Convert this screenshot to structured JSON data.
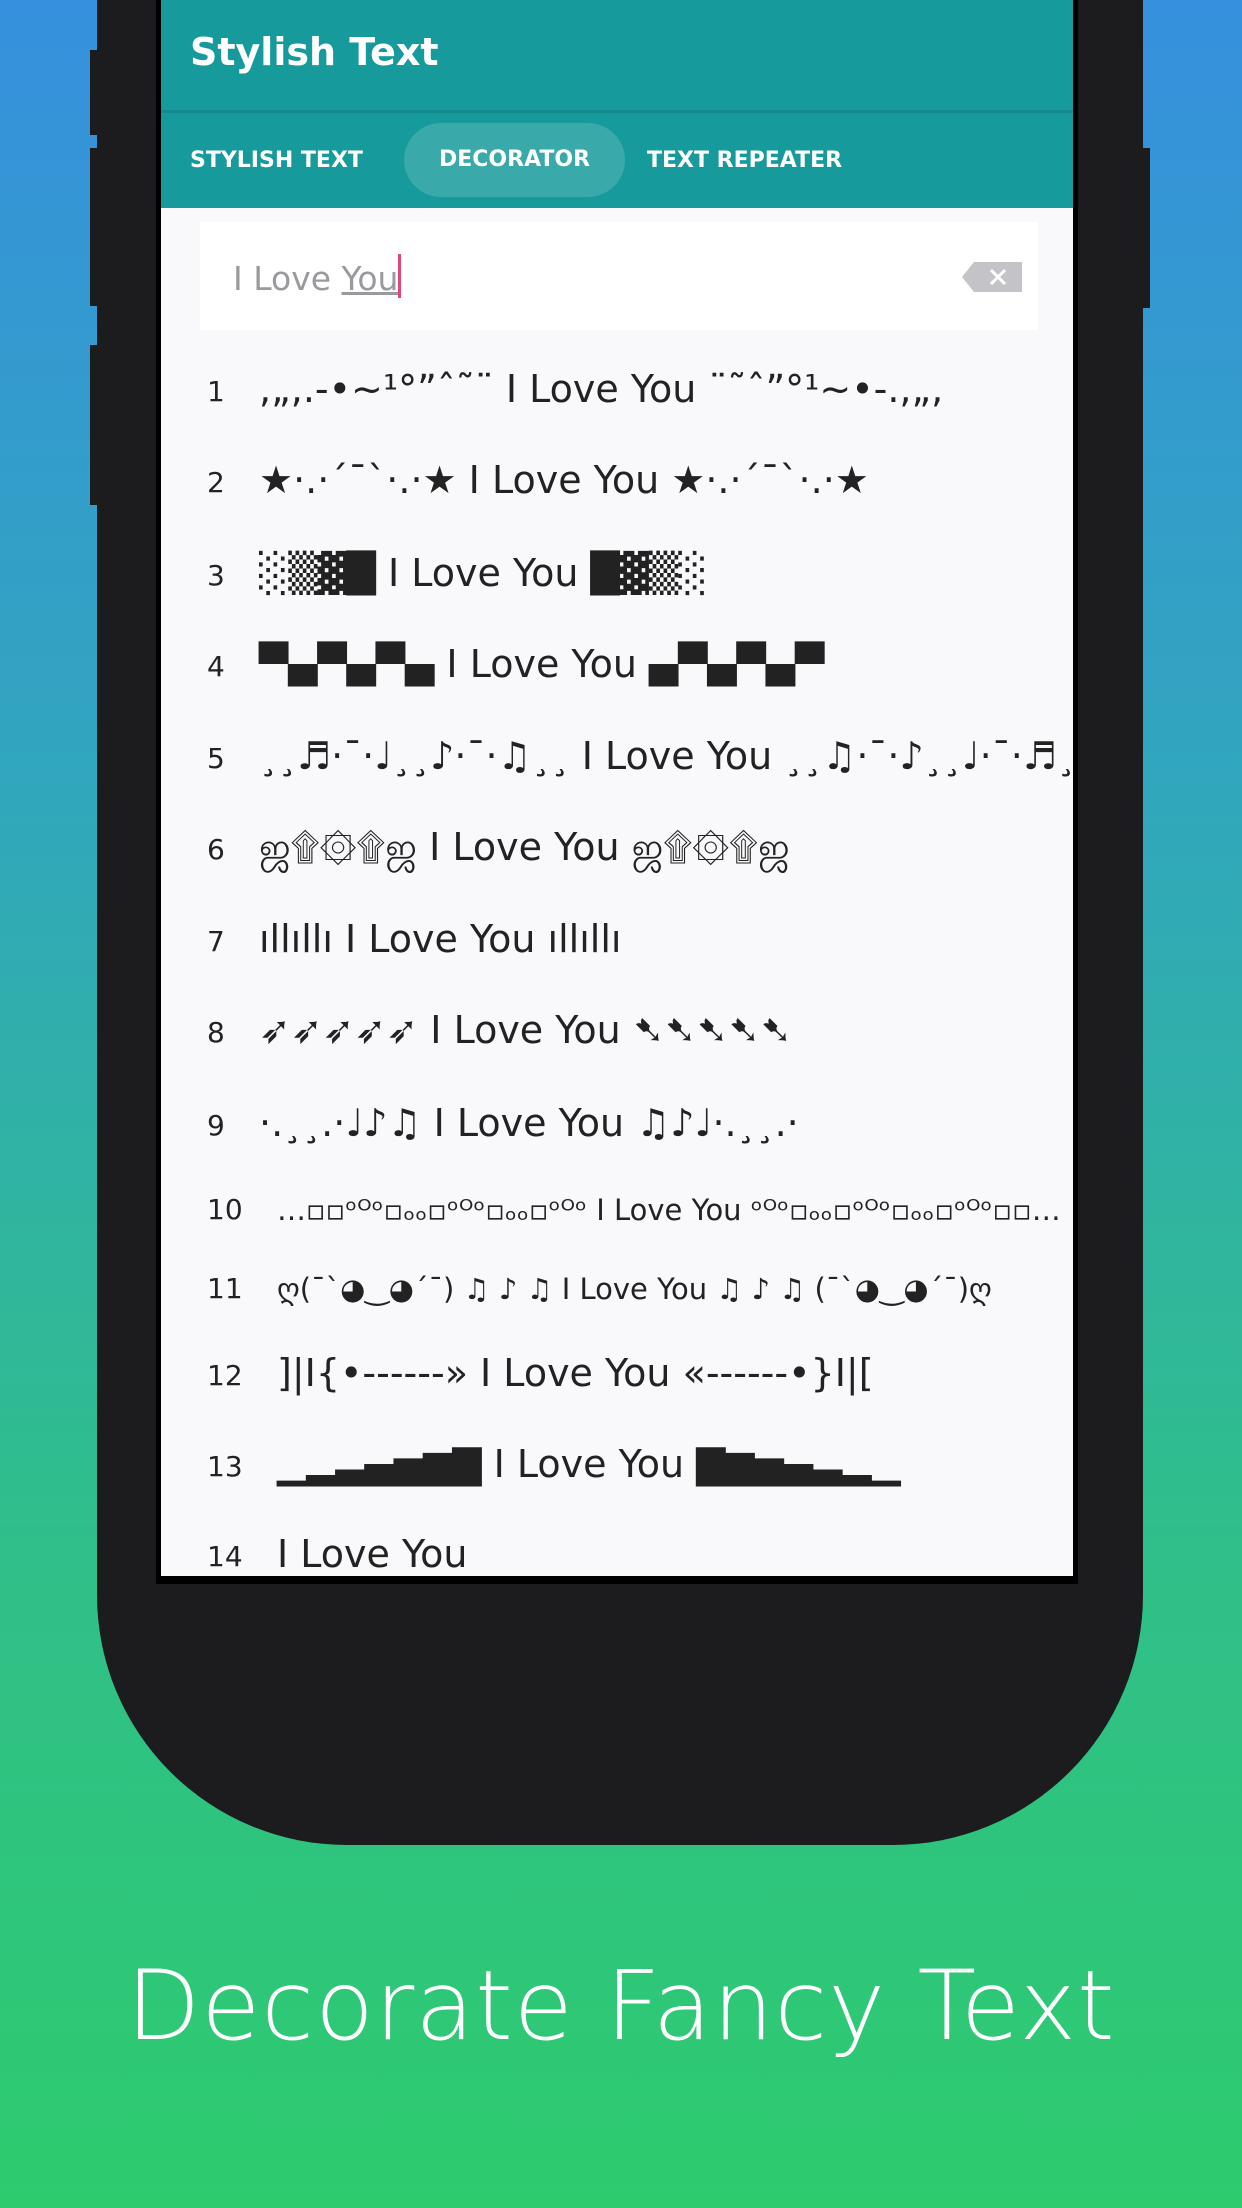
{
  "app": {
    "title": "Stylish Text"
  },
  "tabs": [
    {
      "label": "STYLISH TEXT",
      "active": false
    },
    {
      "label": "DECORATOR",
      "active": true
    },
    {
      "label": "TEXT REPEATER",
      "active": false
    }
  ],
  "input": {
    "value_plain": "I Love ",
    "value_underlined": "You",
    "clear_icon": "backspace-icon"
  },
  "rows": [
    {
      "n": "1",
      "text": ",„,.-•~¹°”ˆ˜¨ I Love You ¨˜ˆ”°¹~•-.,„,"
    },
    {
      "n": "2",
      "text": "★·.·´¯`·.·★ I Love You ★·.·´¯`·.·★"
    },
    {
      "n": "3",
      "text": "░▒▓█ I Love You █▓▒░"
    },
    {
      "n": "4",
      "text": "▀▄▀▄▀▄ I Love You ▄▀▄▀▄▀"
    },
    {
      "n": "5",
      "text": "¸¸♬·¯·♩¸¸♪·¯·♫¸¸ I Love You ¸¸♫·¯·♪¸¸♩·¯·♬¸¸"
    },
    {
      "n": "6",
      "text": "ஜ۩۞۩ஜ I Love You ஜ۩۞۩ஜ"
    },
    {
      "n": "7",
      "text": "ıllıllı I Love You ıllıllı"
    },
    {
      "n": "8",
      "text": "➶➶➶➶➶ I Love You ➷➷➷➷➷"
    },
    {
      "n": "9",
      "text": "·.¸¸.·♩♪♫ I Love You ♫♪♩·.¸¸.·"
    },
    {
      "n": "10",
      "text": "…▫▫ᵒᴼᵒ▫ₒₒ▫ᵒᴼᵒ▫ₒₒ▫ᵒᴼᵒ I Love You ᵒᴼᵒ▫ₒₒ▫ᵒᴼᵒ▫ₒₒ▫ᵒᴼᵒ▫▫…"
    },
    {
      "n": "11",
      "text": "ღ(¯`◕‿◕´¯) ♫ ♪ ♫ I Love You ♫ ♪ ♫ (¯`◕‿◕´¯)ღ"
    },
    {
      "n": "12",
      "text": "]|I{•------» I Love You «------•}I|["
    },
    {
      "n": "13",
      "text": "▁▂▃▄▅▆▇ I Love You ▇▆▅▄▃▂▁"
    },
    {
      "n": "14",
      "text": "I Love You"
    }
  ],
  "caption": "Decorate Fancy Text",
  "colors": {
    "appbar": "#179a9c",
    "caret": "#e0457b",
    "screen_bg": "#f9f8fb",
    "phone": "#1c1b1d"
  }
}
